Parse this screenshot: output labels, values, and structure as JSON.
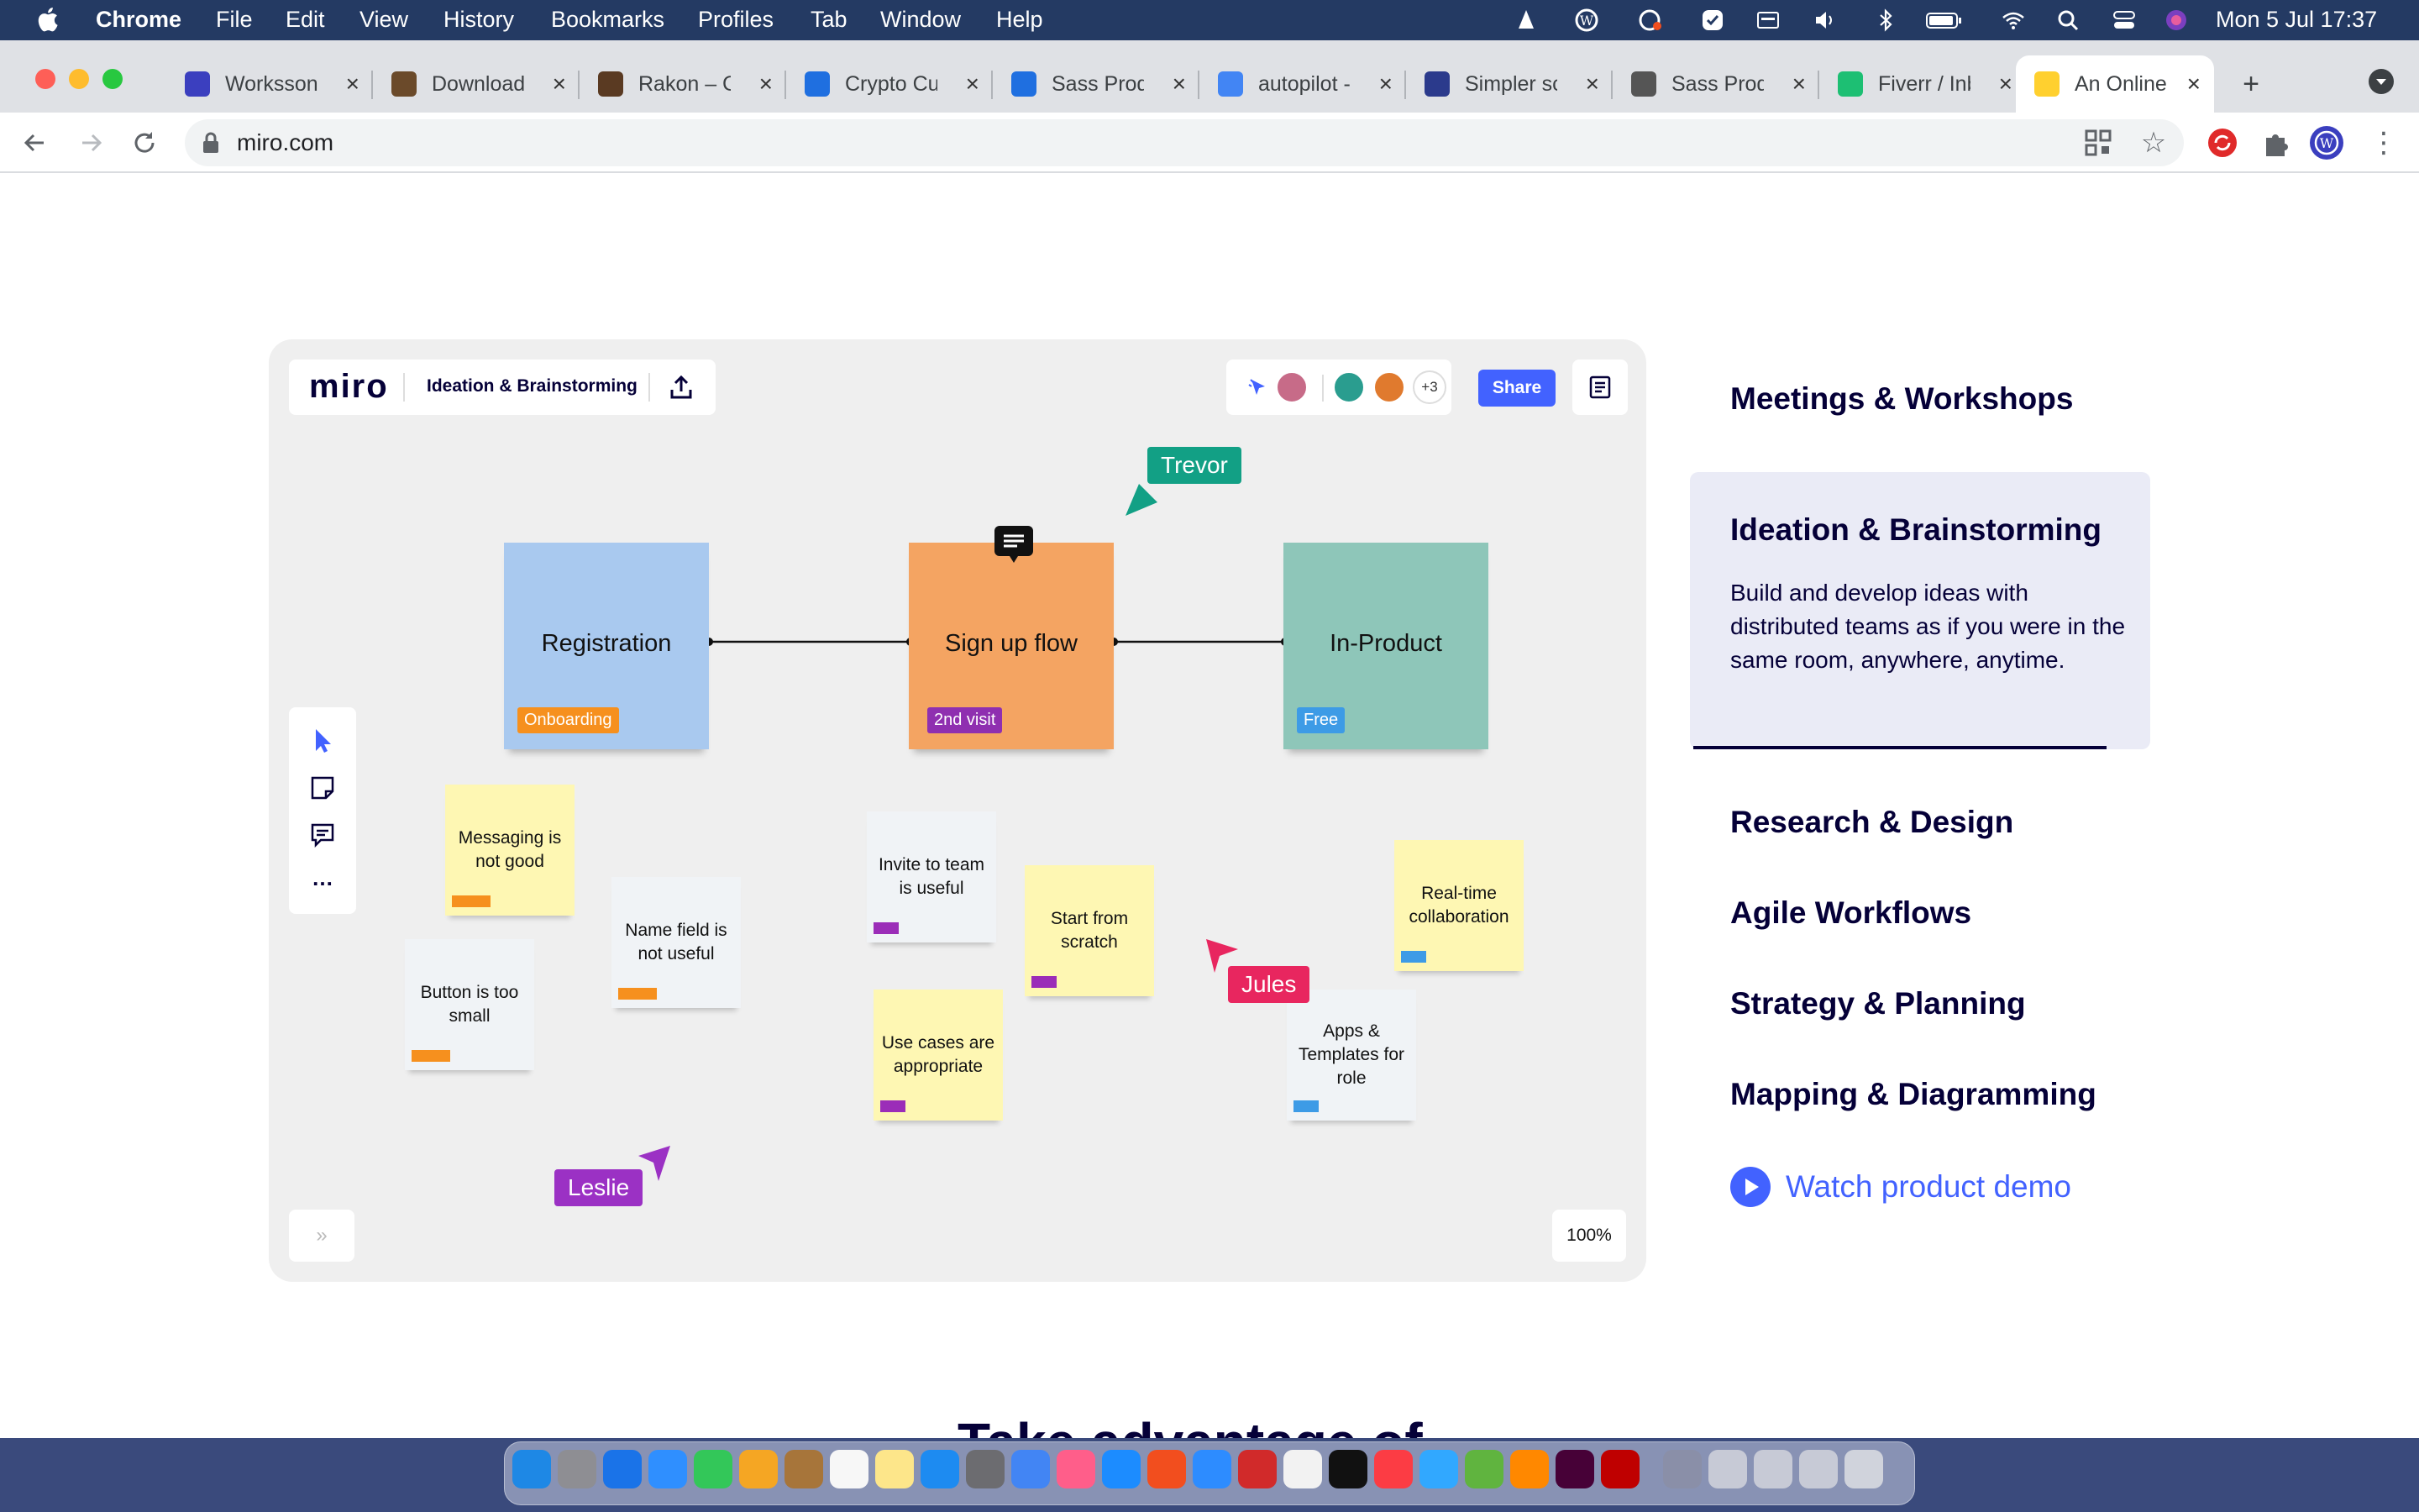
{
  "menubar": {
    "app": "Chrome",
    "menus": [
      "File",
      "Edit",
      "View",
      "History",
      "Bookmarks",
      "Profiles",
      "Tab",
      "Window",
      "Help"
    ],
    "clock": "Mon 5 Jul  17:37"
  },
  "tabs": [
    {
      "title": "Worksson",
      "fav_color": "#3b3fbf"
    },
    {
      "title": "Download",
      "fav_color": "#6b4a2a"
    },
    {
      "title": "Rakon – C",
      "fav_color": "#5a3a22"
    },
    {
      "title": "Crypto Cu",
      "fav_color": "#1f6fe0"
    },
    {
      "title": "Sass Prod",
      "fav_color": "#1f6fe0"
    },
    {
      "title": "autopilot -",
      "fav_color": "#4285f4"
    },
    {
      "title": "Simpler sc",
      "fav_color": "#2b3a8c"
    },
    {
      "title": "Sass Prod",
      "fav_color": "#555555"
    },
    {
      "title": "Fiverr / Inb",
      "fav_color": "#1dbf73"
    },
    {
      "title": "An Online",
      "fav_color": "#ffd02f"
    }
  ],
  "toolbar": {
    "url": "miro.com"
  },
  "board": {
    "logo": "miro",
    "board_name": "Ideation & Brainstorming",
    "share_label": "Share",
    "extra_users": "+3",
    "zoom": "100%",
    "expand": "»",
    "more_tools": "…",
    "cards": [
      {
        "title": "Registration",
        "tag": "Onboarding",
        "color": "#a9c9ef",
        "tag_color": "#f6901e"
      },
      {
        "title": "Sign up flow",
        "tag": "2nd visit",
        "color": "#f4a462",
        "tag_color": "#8f2fb0"
      },
      {
        "title": "In-Product",
        "tag": "Free",
        "color": "#8ec6b9",
        "tag_color": "#3d9be6"
      }
    ],
    "stickies": [
      {
        "text": "Messaging is not good"
      },
      {
        "text": "Button is too small"
      },
      {
        "text": "Name field is not useful"
      },
      {
        "text": "Invite to team is useful"
      },
      {
        "text": "Start from scratch"
      },
      {
        "text": "Use cases are appropriate"
      },
      {
        "text": "Real-time collaboration"
      },
      {
        "text": "Apps  & Templates for role"
      }
    ],
    "cursors": [
      {
        "name": "Trevor",
        "color": "#12a085"
      },
      {
        "name": "Jules",
        "color": "#e8265f"
      },
      {
        "name": "Leslie",
        "color": "#9b31c4"
      }
    ]
  },
  "menu": {
    "items": [
      "Meetings & Workshops",
      "Ideation & Brainstorming",
      "Research & Design",
      "Agile Workflows",
      "Strategy & Planning",
      "Mapping & Diagramming"
    ],
    "active_desc": "Build and develop ideas with distributed teams as if you were in the same room, anywhere, anytime.",
    "demo": "Watch product demo"
  },
  "bottom_title": "Take advantage of"
}
